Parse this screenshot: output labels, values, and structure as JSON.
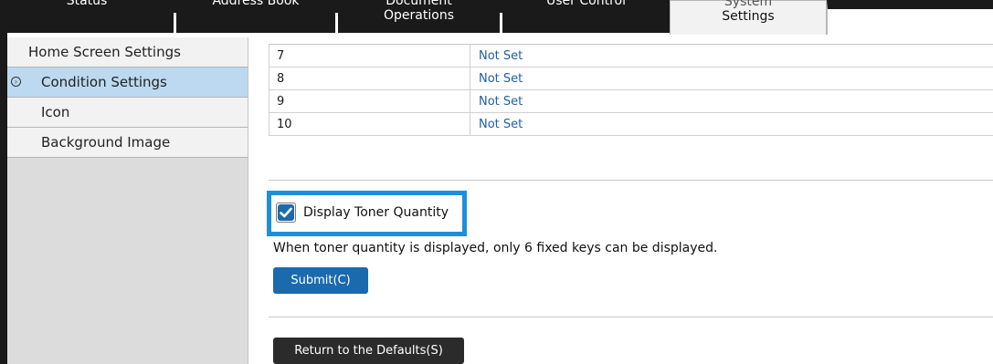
{
  "tabs": [
    {
      "line1": "Status",
      "line2": ""
    },
    {
      "line1": "Address Book",
      "line2": ""
    },
    {
      "line1": "Document",
      "line2": "Operations"
    },
    {
      "line1": "User Control",
      "line2": ""
    },
    {
      "line1": "System",
      "line2": "Settings"
    }
  ],
  "sidebar": {
    "items": [
      {
        "label": "Home Screen Settings"
      },
      {
        "label": "Condition Settings"
      },
      {
        "label": "Icon"
      },
      {
        "label": "Background Image"
      }
    ]
  },
  "table": {
    "rows": [
      {
        "num": "7",
        "value": "Not Set"
      },
      {
        "num": "8",
        "value": "Not Set"
      },
      {
        "num": "9",
        "value": "Not Set"
      },
      {
        "num": "10",
        "value": "Not Set"
      }
    ]
  },
  "options": {
    "display_toner_label": "Display Toner Quantity",
    "display_toner_checked": true,
    "note": "When toner quantity is displayed, only 6 fixed keys can be displayed."
  },
  "buttons": {
    "submit": "Submit(C)",
    "defaults": "Return to the Defaults(S)"
  },
  "colors": {
    "accent": "#1e8fdb",
    "link": "#1f5fa8",
    "submit_bg": "#1a6aad",
    "active_sidebar": "#bcd9ef"
  }
}
